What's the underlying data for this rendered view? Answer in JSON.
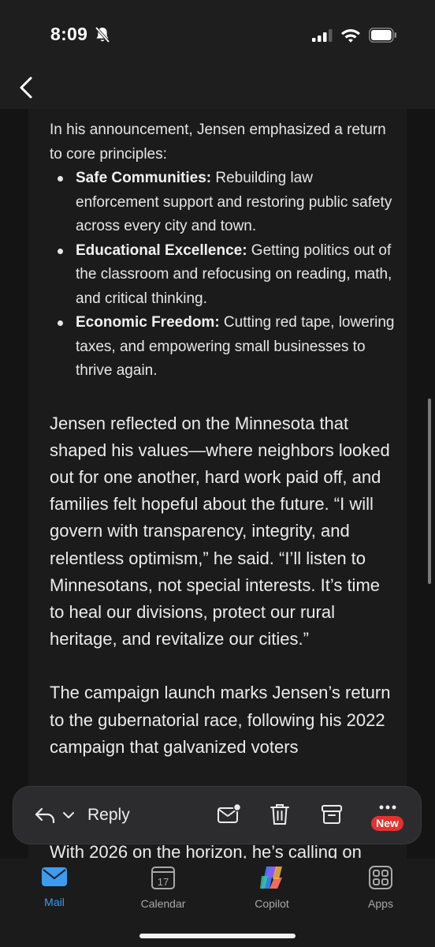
{
  "status_bar": {
    "time": "8:09"
  },
  "article": {
    "intro": "In his announcement, Jensen emphasized a return to core principles:",
    "bullets": [
      {
        "bold": "Safe Communities:",
        "text": " Rebuilding law enforcement support and restoring public safety across every city and town."
      },
      {
        "bold": "Educational Excellence:",
        "text": " Getting politics out of the classroom and refocusing on reading, math, and critical thinking."
      },
      {
        "bold": "Economic Freedom:",
        "text": " Cutting red tape, lowering taxes, and empowering small businesses to thrive again."
      }
    ],
    "para1": "Jensen reflected on the Minnesota that shaped his values—where neighbors looked out for one another, hard work paid off, and families felt hopeful about the future. “I will govern with transparency, integrity, and relentless optimism,” he said. “I’ll listen to Minnesotans, not special interests. It’s time to heal our divisions, protect our rural heritage, and revitalize our cities.”",
    "para2": "The campaign launch marks Jensen’s return to the gubernatorial race, following his 2022 campaign that galvanized voters",
    "para3": "With 2026 on the horizon, he’s calling on"
  },
  "action_bar": {
    "reply_label": "Reply",
    "new_badge": "New"
  },
  "tabs": [
    {
      "label": "Mail",
      "icon": "mail-icon",
      "active": true
    },
    {
      "label": "Calendar",
      "icon": "calendar-icon",
      "date": "17"
    },
    {
      "label": "Copilot",
      "icon": "copilot-icon"
    },
    {
      "label": "Apps",
      "icon": "apps-grid-icon"
    }
  ],
  "colors": {
    "accent": "#3b9cf0",
    "badge": "#e5312f",
    "background": "#141414"
  }
}
